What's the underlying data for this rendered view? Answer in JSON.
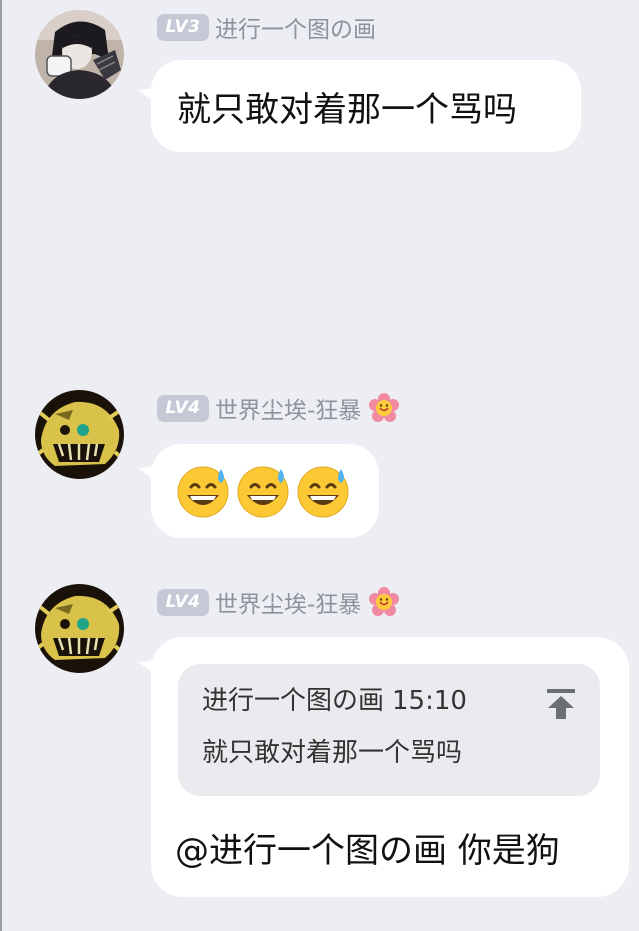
{
  "messages": [
    {
      "user": {
        "level": "LV3",
        "name": "进行一个图の画",
        "avatar": "avatar-user1"
      },
      "text": "就只敢对着那一个骂吗"
    },
    {
      "user": {
        "level": "LV4",
        "name": "世界尘埃-狂暴",
        "badge": "flower-emoji",
        "avatar": "avatar-user2"
      },
      "emojis": [
        "sweat-smile-emoji",
        "sweat-smile-emoji",
        "sweat-smile-emoji"
      ]
    },
    {
      "user": {
        "level": "LV4",
        "name": "世界尘埃-狂暴",
        "badge": "flower-emoji",
        "avatar": "avatar-user2"
      },
      "quote": {
        "author": "进行一个图の画",
        "time": "15:10",
        "text": "就只敢对着那一个骂吗",
        "icon": "jump-to-top-icon"
      },
      "text": "@进行一个图の画 你是狗"
    }
  ],
  "colors": {
    "background": "#eceef4",
    "bubble": "#ffffff",
    "quote_bg": "#eaebee",
    "level_badge": "#c4c9d5",
    "username": "#8e929c"
  }
}
